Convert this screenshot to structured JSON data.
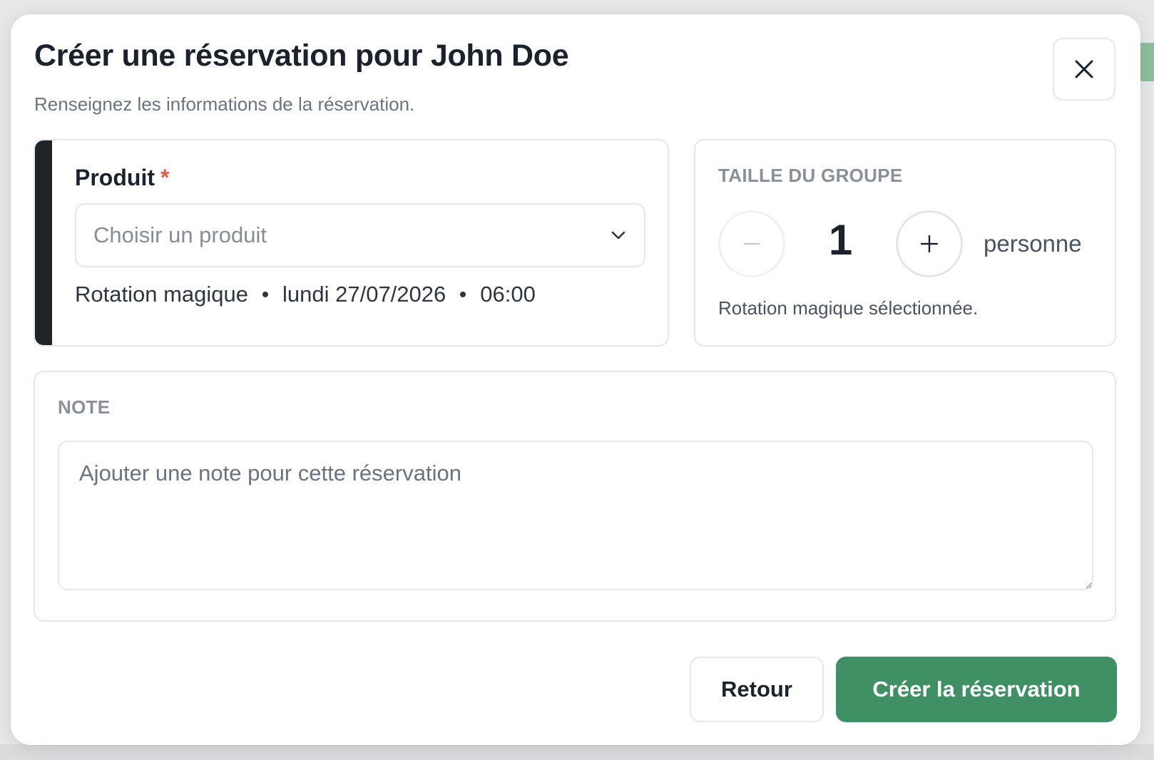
{
  "dialog": {
    "title": "Créer une réservation pour John Doe",
    "subtitle": "Renseignez les informations de la réservation.",
    "close_icon": "close-icon"
  },
  "product": {
    "label": "Produit",
    "required_marker": "*",
    "placeholder": "Choisir un produit",
    "dropdown_icon": "chevron-down-icon",
    "session": {
      "activity": "Rotation magique",
      "date": "lundi 27/07/2026",
      "time": "06:00"
    }
  },
  "group_size": {
    "label": "TAILLE DU GROUPE",
    "count": "1",
    "unit": "personne",
    "decrement_icon": "minus-icon",
    "increment_icon": "plus-icon",
    "hint": "Rotation magique sélectionnée."
  },
  "note": {
    "label": "NOTE",
    "placeholder": "Ajouter une note pour cette réservation"
  },
  "actions": {
    "back_label": "Retour",
    "submit_label": "Créer la réservation"
  },
  "colors": {
    "accent_bar": "#1f2429",
    "required": "#e05a47",
    "primary_button": "#3f9064"
  }
}
